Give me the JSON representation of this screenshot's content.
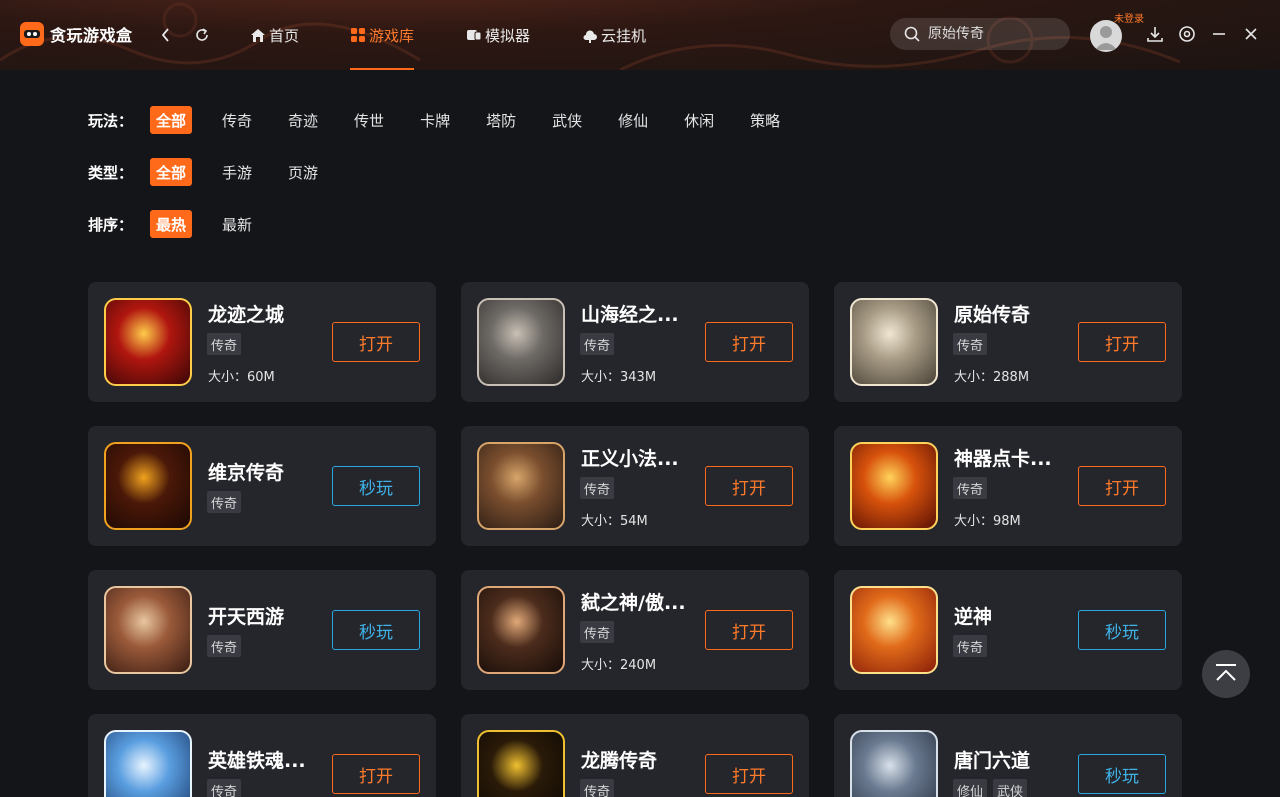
{
  "app": {
    "title": "贪玩游戏盒"
  },
  "nav": {
    "tabs": [
      {
        "label": "首页",
        "icon": "home-icon"
      },
      {
        "label": "游戏库",
        "icon": "grid-icon",
        "active": true
      },
      {
        "label": "模拟器",
        "icon": "emulator-icon"
      },
      {
        "label": "云挂机",
        "icon": "cloud-icon"
      }
    ]
  },
  "search": {
    "placeholder": "原始传奇"
  },
  "user": {
    "login_tip": "未登录"
  },
  "filters": {
    "gameplay": {
      "label": "玩法：",
      "options": [
        "全部",
        "传奇",
        "奇迹",
        "传世",
        "卡牌",
        "塔防",
        "武侠",
        "修仙",
        "休闲",
        "策略"
      ],
      "selected": "全部"
    },
    "type": {
      "label": "类型：",
      "options": [
        "全部",
        "手游",
        "页游"
      ],
      "selected": "全部"
    },
    "sort": {
      "label": "排序：",
      "options": [
        "最热",
        "最新"
      ],
      "selected": "最热"
    }
  },
  "games": [
    {
      "name": "龙迹之城",
      "tags": [
        "传奇"
      ],
      "size": "大小：60M",
      "button": "打开",
      "btn_type": "open",
      "palette": [
        "#b0160f",
        "#3a0705",
        "#ffcc4a"
      ]
    },
    {
      "name": "山海经之...",
      "tags": [
        "传奇"
      ],
      "size": "大小：343M",
      "button": "打开",
      "btn_type": "open",
      "palette": [
        "#6e6a66",
        "#2c2a28",
        "#c9c0b5"
      ]
    },
    {
      "name": "原始传奇",
      "tags": [
        "传奇"
      ],
      "size": "大小：288M",
      "button": "打开",
      "btn_type": "open",
      "palette": [
        "#a89c86",
        "#4a4237",
        "#f0e6d2"
      ]
    },
    {
      "name": "维京传奇",
      "tags": [
        "传奇"
      ],
      "size": "",
      "button": "秒玩",
      "btn_type": "play",
      "palette": [
        "#4a1808",
        "#1c0804",
        "#f0a21e"
      ]
    },
    {
      "name": "正义小法...",
      "tags": [
        "传奇"
      ],
      "size": "大小：54M",
      "button": "打开",
      "btn_type": "open",
      "palette": [
        "#7a4e2e",
        "#2a1c14",
        "#d7a56a"
      ]
    },
    {
      "name": "神器点卡...",
      "tags": [
        "传奇"
      ],
      "size": "大小：98M",
      "button": "打开",
      "btn_type": "open",
      "palette": [
        "#d7520c",
        "#5a1004",
        "#ffd35a"
      ]
    },
    {
      "name": "开天西游",
      "tags": [
        "传奇"
      ],
      "size": "",
      "button": "秒玩",
      "btn_type": "play",
      "palette": [
        "#9a5a3a",
        "#3a1c12",
        "#e8c7a0"
      ]
    },
    {
      "name": "弑之神/傲...",
      "tags": [
        "传奇"
      ],
      "size": "大小：240M",
      "button": "打开",
      "btn_type": "open",
      "palette": [
        "#4c2c1c",
        "#160c08",
        "#e0a878"
      ]
    },
    {
      "name": "逆神",
      "tags": [
        "传奇"
      ],
      "size": "",
      "button": "秒玩",
      "btn_type": "play",
      "palette": [
        "#e06a1a",
        "#8a1e08",
        "#ffe08a"
      ]
    },
    {
      "name": "英雄铁魂...",
      "tags": [
        "传奇"
      ],
      "size": "",
      "button": "打开",
      "btn_type": "open",
      "palette": [
        "#5a9ee0",
        "#1c3c6e",
        "#e8f4ff"
      ]
    },
    {
      "name": "龙腾传奇",
      "tags": [
        "传奇"
      ],
      "size": "",
      "button": "打开",
      "btn_type": "open",
      "palette": [
        "#2a1a08",
        "#0c0804",
        "#f0c030"
      ]
    },
    {
      "name": "唐门六道",
      "tags": [
        "修仙",
        "武侠"
      ],
      "size": "",
      "button": "秒玩",
      "btn_type": "play",
      "palette": [
        "#6a7a90",
        "#2c3444",
        "#d8e0ea"
      ]
    }
  ]
}
